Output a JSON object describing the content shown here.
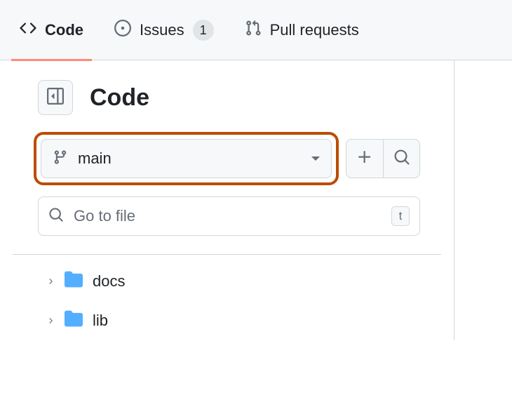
{
  "tabs": {
    "code": {
      "label": "Code"
    },
    "issues": {
      "label": "Issues",
      "count": "1"
    },
    "pulls": {
      "label": "Pull requests"
    }
  },
  "page": {
    "title": "Code"
  },
  "branch": {
    "name": "main"
  },
  "search": {
    "placeholder": "Go to file",
    "key_hint": "t"
  },
  "tree": {
    "items": [
      {
        "name": "docs"
      },
      {
        "name": "lib"
      }
    ]
  }
}
